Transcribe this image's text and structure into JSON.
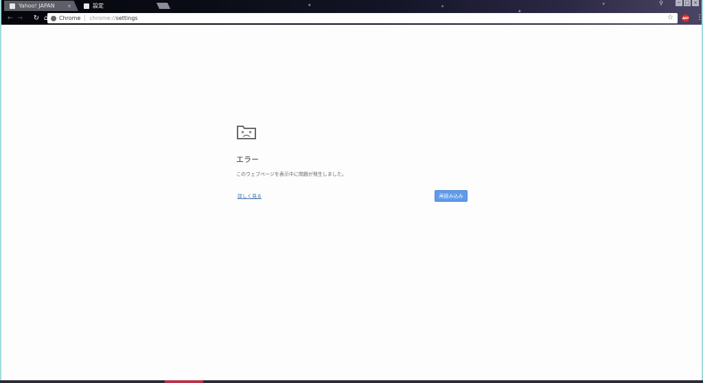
{
  "tabs": [
    {
      "title": "Yahoo! JAPAN",
      "close": "×"
    },
    {
      "title": "設定"
    }
  ],
  "window_controls": {
    "minimize": "−",
    "restore": "□",
    "close": "×",
    "user": "⚲"
  },
  "toolbar": {
    "back": "←",
    "forward": "→",
    "reload": "↻",
    "home": "⌂",
    "menu": "⋮"
  },
  "omnibox": {
    "chip_label": "Chrome",
    "scheme": "chrome://",
    "host": "settings",
    "star": "☆"
  },
  "extension": {
    "abp_label": "ABP"
  },
  "error_page": {
    "title": "エラー",
    "description": "このウェブページを表示中に問題が発生しました。",
    "details_link": "詳しく見る",
    "reload_button": "再読み込み"
  }
}
